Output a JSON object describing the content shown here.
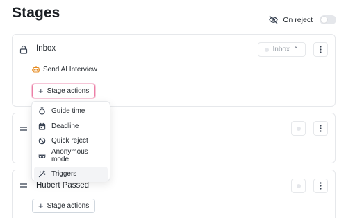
{
  "page": {
    "title": "Stages"
  },
  "header": {
    "on_reject_label": "On reject",
    "on_reject_enabled": false
  },
  "stages": [
    {
      "name": "Inbox",
      "locked": true,
      "status_chip": "Inbox",
      "actions": [
        "Send AI Interview"
      ],
      "stage_actions_label": "Stage actions"
    },
    {
      "name": "",
      "locked": false,
      "status_chip": "",
      "actions": []
    },
    {
      "name": "Hubert Passed",
      "locked": false,
      "status_chip": "",
      "actions": [],
      "stage_actions_label": "Stage actions"
    }
  ],
  "dropdown_menu": {
    "items": [
      {
        "label": "Guide time",
        "icon": "stopwatch-icon"
      },
      {
        "label": "Deadline",
        "icon": "calendar-icon"
      },
      {
        "label": "Quick reject",
        "icon": "ban-icon"
      },
      {
        "label": "Anonymous mode",
        "icon": "incognito-icon"
      },
      {
        "label": "Triggers",
        "icon": "magic-wand-icon"
      }
    ]
  },
  "colors": {
    "focus_border": "#ec7fa6",
    "robot_icon": "#e58a1f",
    "border": "#e6e8eb",
    "menu_hover": "#f3f4f6"
  }
}
